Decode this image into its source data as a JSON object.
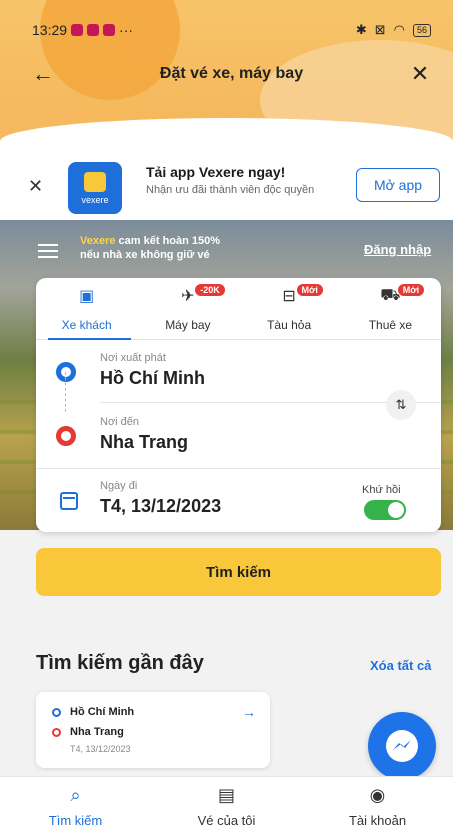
{
  "status_bar": {
    "time": "13:29",
    "more": "···",
    "battery": "56"
  },
  "header": {
    "title": "Đặt vé xe, máy bay",
    "back_icon": "arrow-left-icon",
    "close_icon": "close-icon"
  },
  "promo": {
    "title": "Tải app Vexere ngay!",
    "subtitle": "Nhận ưu đãi thành viên độc quyền",
    "open_button": "Mở app",
    "logo_text": "vexere"
  },
  "banner": {
    "brand": "Vexere",
    "guarantee_line1": " cam kết hoàn 150%",
    "guarantee_line2": "nếu nhà xe không giữ vé",
    "login": "Đăng nhập"
  },
  "tabs": [
    {
      "label": "Xe khách",
      "icon": "bus-icon",
      "badge": "",
      "active": true
    },
    {
      "label": "Máy bay",
      "icon": "plane-icon",
      "badge": "-20K",
      "active": false
    },
    {
      "label": "Tàu hỏa",
      "icon": "train-icon",
      "badge": "Mới",
      "active": false
    },
    {
      "label": "Thuê xe",
      "icon": "car-rental-icon",
      "badge": "Mới",
      "active": false
    }
  ],
  "search_form": {
    "origin_label": "Nơi xuất phát",
    "origin_value": "Hồ Chí Minh",
    "destination_label": "Nơi đến",
    "destination_value": "Nha Trang",
    "date_label": "Ngày đi",
    "date_value": "T4, 13/12/2023",
    "round_trip_label": "Khứ hồi",
    "round_trip_on": true,
    "search_button": "Tìm kiếm"
  },
  "recent": {
    "title": "Tìm kiếm gần đây",
    "clear_all": "Xóa tất cả",
    "items": [
      {
        "from": "Hồ Chí Minh",
        "to": "Nha Trang",
        "date": "T4, 13/12/2023"
      }
    ]
  },
  "bottom_nav": [
    {
      "label": "Tìm kiếm",
      "icon": "search-icon",
      "active": true
    },
    {
      "label": "Vé của tôi",
      "icon": "ticket-icon",
      "active": false
    },
    {
      "label": "Tài khoản",
      "icon": "user-icon",
      "active": false
    }
  ],
  "colors": {
    "primary": "#1e6fd9",
    "accent": "#f8c73a",
    "badge": "#e53935",
    "toggle_on": "#35b24a"
  }
}
